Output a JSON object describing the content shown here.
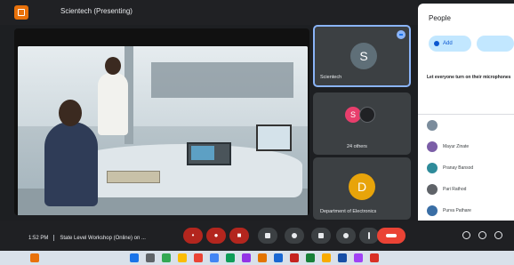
{
  "window": {
    "title": "Scientech (Presenting)"
  },
  "tiles": [
    {
      "label": "Scientech",
      "avatar_letter": "S"
    },
    {
      "label": "24 others",
      "avatar_letter": "S"
    },
    {
      "label": "Department of Electronics",
      "avatar_letter": "D"
    }
  ],
  "people_panel": {
    "title": "People",
    "add_label": "Add",
    "second_label": "",
    "prompt": "Let everyone turn on their microphones",
    "participants": [
      {
        "name": "",
        "color": "#7b8c9c"
      },
      {
        "name": "Mayur Zinate",
        "color": "#7b5ea7"
      },
      {
        "name": "Pranay Bansod",
        "color": "#2e8b9a"
      },
      {
        "name": "Pari Rathod",
        "color": "#5f6368"
      },
      {
        "name": "Purva Pathare",
        "color": "#3a6ea5"
      }
    ]
  },
  "bottom_bar": {
    "time": "1:52 PM",
    "meeting_name": "State Level Workshop (Online) on ..."
  },
  "icons": {
    "mic": "mic-off-icon",
    "camera": "camera-off-icon",
    "captions": "captions-icon",
    "emoji": "emoji-icon",
    "present": "present-icon",
    "hand": "raise-hand-icon",
    "more": "more-icon",
    "leave": "leave-call-icon"
  }
}
